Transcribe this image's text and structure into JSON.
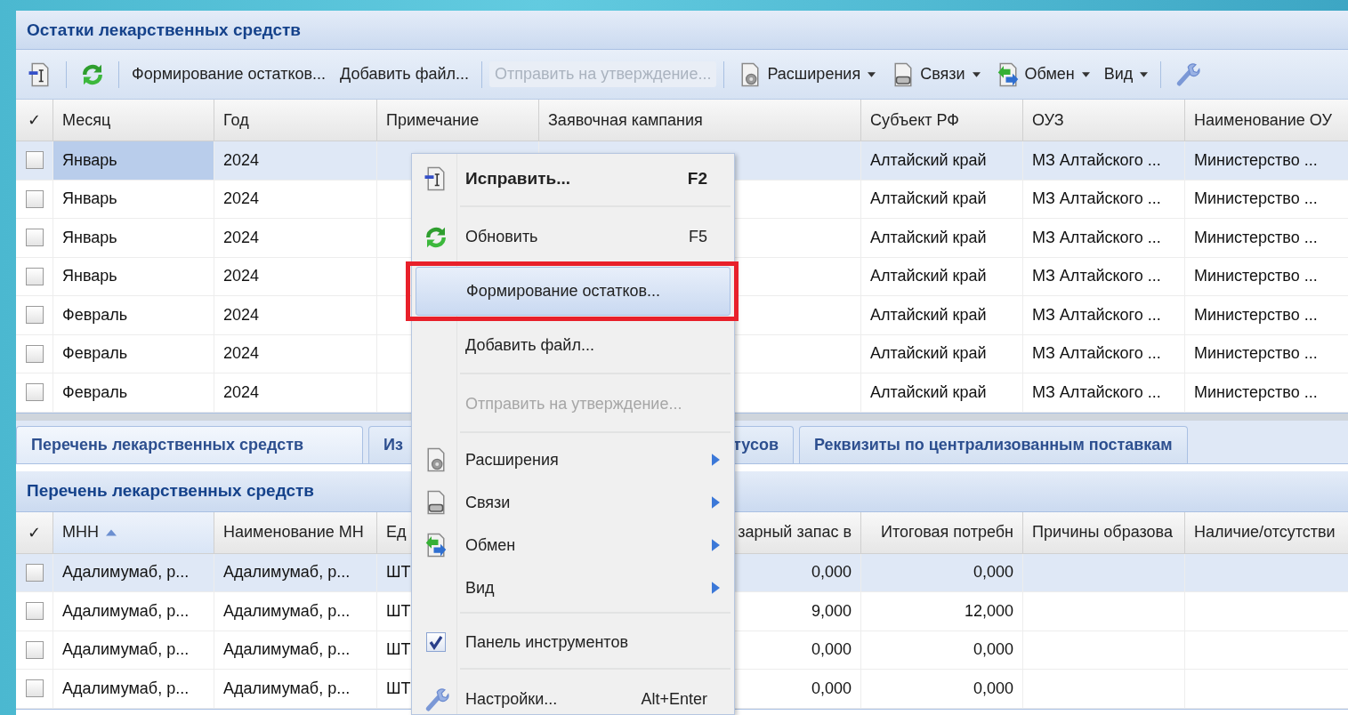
{
  "panel_title": "Остатки лекарственных средств",
  "toolbar": [
    {
      "kind": "icon",
      "disabled": false
    },
    {
      "kind": "separator"
    },
    {
      "kind": "icon",
      "disabled": false
    },
    {
      "kind": "separator"
    },
    {
      "kind": "text",
      "label": "Формирование остатков...",
      "disabled": false
    },
    {
      "kind": "text",
      "label": "Добавить файл...",
      "disabled": false
    },
    {
      "kind": "separator"
    },
    {
      "kind": "text",
      "label": "Отправить на утверждение...",
      "disabled": true
    },
    {
      "kind": "separator"
    },
    {
      "kind": "dropdown",
      "label": "Расширения",
      "disabled": false
    },
    {
      "kind": "dropdown",
      "label": "Связи",
      "disabled": false
    },
    {
      "kind": "dropdown",
      "label": "Обмен",
      "disabled": false
    },
    {
      "kind": "dropdown",
      "label": "Вид",
      "disabled": false
    },
    {
      "kind": "separator"
    },
    {
      "kind": "icon",
      "disabled": false
    }
  ],
  "top_table": {
    "check_header": "✓",
    "columns": [
      {
        "label": "Месяц"
      },
      {
        "label": "Год"
      },
      {
        "label": "Примечание"
      },
      {
        "label": "Заявочная кампания"
      },
      {
        "label": "Субъект РФ"
      },
      {
        "label": "ОУЗ"
      },
      {
        "label": "Наименование ОУ"
      }
    ],
    "rows": [
      {
        "checked": false,
        "selected": true,
        "cells": [
          "Январь",
          "2024",
          null,
          null,
          "Алтайский край",
          "МЗ Алтайского ...",
          "Министерство ..."
        ]
      },
      {
        "checked": false,
        "selected": false,
        "cells": [
          "Январь",
          "2024",
          null,
          null,
          "Алтайский край",
          "МЗ Алтайского ...",
          "Министерство ..."
        ]
      },
      {
        "checked": false,
        "selected": false,
        "cells": [
          "Январь",
          "2024",
          null,
          null,
          "Алтайский край",
          "МЗ Алтайского ...",
          "Министерство ..."
        ]
      },
      {
        "checked": false,
        "selected": false,
        "cells": [
          "Январь",
          "2024",
          null,
          null,
          "Алтайский край",
          "МЗ Алтайского ...",
          "Министерство ..."
        ]
      },
      {
        "checked": false,
        "selected": false,
        "cells": [
          "Февраль",
          "2024",
          null,
          null,
          "Алтайский край",
          "МЗ Алтайского ...",
          "Министерство ..."
        ]
      },
      {
        "checked": false,
        "selected": false,
        "cells": [
          "Февраль",
          "2024",
          null,
          null,
          "Алтайский край",
          "МЗ Алтайского ...",
          "Министерство ..."
        ]
      },
      {
        "checked": false,
        "selected": false,
        "cells": [
          "Февраль",
          "2024",
          null,
          null,
          "Алтайский край",
          "МЗ Алтайского ...",
          "Министерство ..."
        ]
      }
    ]
  },
  "tabs": [
    {
      "label": "Перечень лекарственных средств",
      "selected": true
    },
    {
      "label": "Из",
      "selected": false
    },
    {
      "label": "тусов",
      "selected": false
    },
    {
      "label": "Реквизиты по централизованным поставкам",
      "selected": false
    }
  ],
  "detail_title": "Перечень лекарственных средств",
  "detail_table": {
    "check_header": "✓",
    "columns": [
      {
        "label": "МНН",
        "kind": "text",
        "sorted": true
      },
      {
        "label": "Наименование МН",
        "kind": "text",
        "sorted": false
      },
      {
        "label": "Ед",
        "kind": "text",
        "sorted": false
      },
      {
        "label": "зарный запас в",
        "kind": "number",
        "sorted": false
      },
      {
        "label": "Итоговая потребн",
        "kind": "number",
        "sorted": false
      },
      {
        "label": "Причины образова",
        "kind": "text",
        "sorted": false
      },
      {
        "label": "Наличие/отсутстви",
        "kind": "text",
        "sorted": false
      }
    ],
    "rows": [
      {
        "checked": false,
        "selected": true,
        "cells": [
          "Адалимумаб, р...",
          "Адалимумаб, р...",
          "ШТ",
          "0,000",
          "0,000",
          null,
          null
        ]
      },
      {
        "checked": false,
        "selected": false,
        "cells": [
          "Адалимумаб, р...",
          "Адалимумаб, р...",
          "ШТ",
          "9,000",
          "12,000",
          null,
          null
        ]
      },
      {
        "checked": false,
        "selected": false,
        "cells": [
          "Адалимумаб, р...",
          "Адалимумаб, р...",
          "ШТ",
          "0,000",
          "0,000",
          null,
          null
        ]
      },
      {
        "checked": false,
        "selected": false,
        "cells": [
          "Адалимумаб, р...",
          "Адалимумаб, р...",
          "ШТ",
          "0,000",
          "0,000",
          null,
          null
        ]
      }
    ]
  },
  "context_menu": [
    {
      "kind": "item",
      "label": "Исправить...",
      "shortcut": "F2",
      "default": true,
      "selected": false,
      "disabled": false
    },
    {
      "kind": "separator"
    },
    {
      "kind": "item",
      "label": "Обновить",
      "shortcut": "F5",
      "default": false,
      "selected": false,
      "disabled": false
    },
    {
      "kind": "item",
      "label": "Формирование остатков...",
      "default": false,
      "selected": true,
      "disabled": false
    },
    {
      "kind": "item",
      "label": "Добавить файл...",
      "default": false,
      "selected": false,
      "disabled": false
    },
    {
      "kind": "separator"
    },
    {
      "kind": "item",
      "label": "Отправить на утверждение...",
      "default": false,
      "selected": false,
      "disabled": true
    },
    {
      "kind": "separator"
    },
    {
      "kind": "submenu",
      "label": "Расширения",
      "default": false,
      "selected": false,
      "disabled": false
    },
    {
      "kind": "submenu",
      "label": "Связи",
      "default": false,
      "selected": false,
      "disabled": false
    },
    {
      "kind": "submenu",
      "label": "Обмен",
      "default": false,
      "selected": false,
      "disabled": false
    },
    {
      "kind": "submenu",
      "label": "Вид",
      "default": false,
      "selected": false,
      "disabled": false
    },
    {
      "kind": "separator"
    },
    {
      "kind": "check",
      "label": "Панель инструментов",
      "checked": true,
      "default": false,
      "selected": false,
      "disabled": false
    },
    {
      "kind": "separator"
    },
    {
      "kind": "item",
      "label": "Настройки...",
      "shortcut": "Alt+Enter",
      "default": false,
      "selected": false,
      "disabled": false
    }
  ]
}
